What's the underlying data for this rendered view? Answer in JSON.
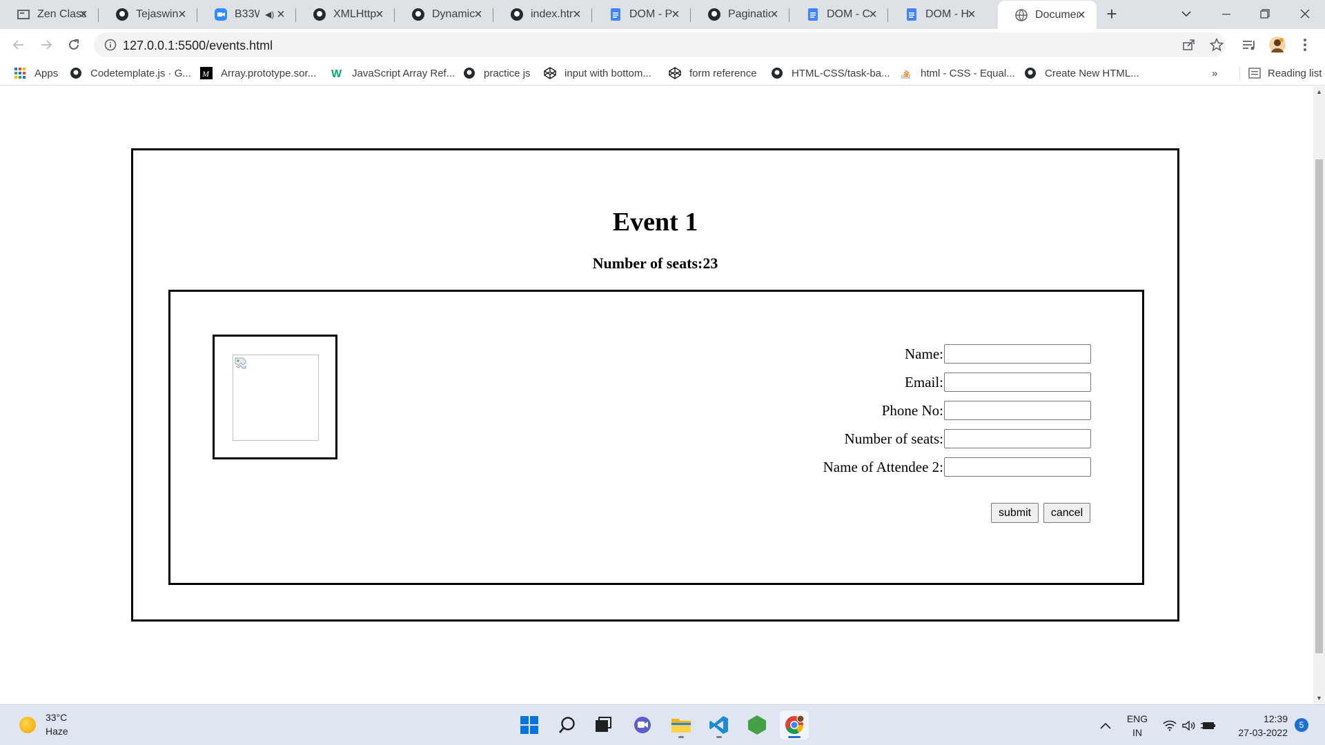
{
  "browser": {
    "tabs": [
      {
        "title": "Zen Class",
        "icon": "zen-class-icon"
      },
      {
        "title": "Tejaswini",
        "icon": "github-icon"
      },
      {
        "title": "B33W",
        "icon": "zoom-icon",
        "muted": true
      },
      {
        "title": "XMLHttp",
        "icon": "github-icon"
      },
      {
        "title": "Dynamic",
        "icon": "github-icon"
      },
      {
        "title": "index.htm",
        "icon": "github-icon"
      },
      {
        "title": "DOM - Pa",
        "icon": "google-docs-icon"
      },
      {
        "title": "Paginatio",
        "icon": "github-icon"
      },
      {
        "title": "DOM - C",
        "icon": "google-docs-icon"
      },
      {
        "title": "DOM - H",
        "icon": "google-docs-icon"
      },
      {
        "title": "Documen",
        "icon": "globe-icon",
        "active": true
      }
    ],
    "url": "127.0.0.1:5500/events.html",
    "bookmarks": [
      {
        "label": "Apps",
        "icon": "apps-grid-icon"
      },
      {
        "label": "Codetemplate.js · G...",
        "icon": "github-icon"
      },
      {
        "label": "Array.prototype.sor...",
        "icon": "mdn-icon"
      },
      {
        "label": "JavaScript Array Ref...",
        "icon": "w3schools-icon"
      },
      {
        "label": "practice js",
        "icon": "github-icon"
      },
      {
        "label": "input with bottom...",
        "icon": "codepen-icon"
      },
      {
        "label": "form reference",
        "icon": "codepen-icon"
      },
      {
        "label": "HTML-CSS/task-ba...",
        "icon": "github-icon"
      },
      {
        "label": "html - CSS - Equal...",
        "icon": "stackoverflow-icon"
      },
      {
        "label": "Create New HTML...",
        "icon": "github-icon"
      }
    ],
    "bookmarks_overflow": "»",
    "reading_list": "Reading list"
  },
  "page": {
    "event_title": "Event 1",
    "seats_text": "Number of seats:23",
    "form": {
      "fields": [
        {
          "label": "Name:",
          "value": ""
        },
        {
          "label": "Email:",
          "value": ""
        },
        {
          "label": "Phone No:",
          "value": ""
        },
        {
          "label": "Number of seats:",
          "value": ""
        },
        {
          "label": "Name of Attendee 2:",
          "value": ""
        }
      ],
      "submit_label": "submit",
      "cancel_label": "cancel"
    }
  },
  "taskbar": {
    "weather_temp": "33°C",
    "weather_desc": "Haze",
    "apps": [
      "windows-start-icon",
      "search-icon",
      "task-view-icon",
      "teams-chat-icon",
      "file-explorer-icon",
      "vscode-icon",
      "nodejs-icon",
      "chrome-icon"
    ],
    "lang_line1": "ENG",
    "lang_line2": "IN",
    "time": "12:39",
    "date": "27-03-2022",
    "notifications": "5"
  }
}
